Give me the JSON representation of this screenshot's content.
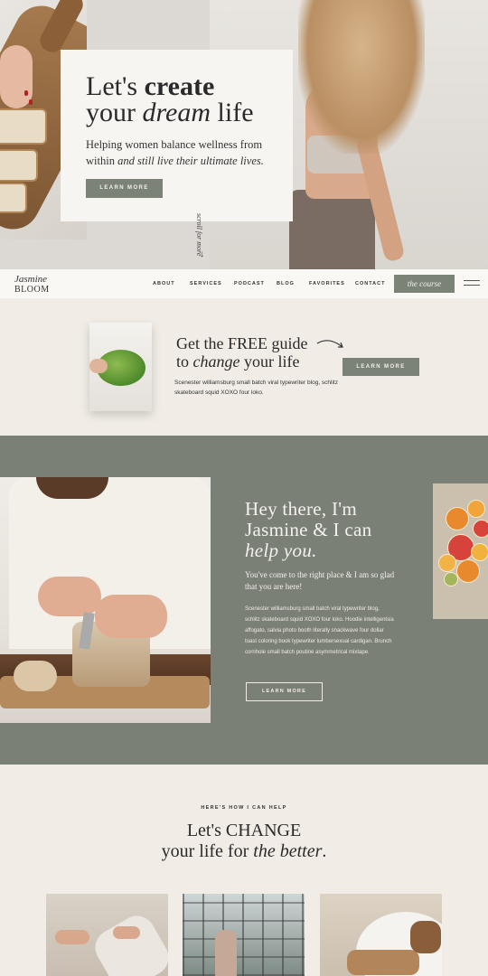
{
  "hero": {
    "title_line1_a": "Let's ",
    "title_line1_b": "create",
    "title_line2_a": "your ",
    "title_line2_b": "dream",
    "title_line2_c": " life",
    "subtitle_a": "Helping women balance wellness from within ",
    "subtitle_b": "and still live their ultimate lives.",
    "button": "LEARN MORE",
    "scroll_hint": "scroll for more",
    "scroll_arrow": "↓"
  },
  "nav": {
    "logo_line1": "Jasmine",
    "logo_line2": "BLOOM",
    "items": [
      "ABOUT",
      "SERVICES",
      "PODCAST",
      "BLOG",
      "FAVORITES",
      "CONTACT"
    ],
    "cta": "the course"
  },
  "guide": {
    "title_line1": "Get the FREE guide",
    "title_line2_a": "to ",
    "title_line2_b": "change",
    "title_line2_c": " your life",
    "text": "Scenester williamsburg small batch viral typewriter blog, schlitz skateboard squid XOXO four loko.",
    "button": "LEARN MORE"
  },
  "about": {
    "title_line1": "Hey there, I'm",
    "title_line2": "Jasmine & I can",
    "title_line3": "help you.",
    "subtitle": "You've come to the right place & I am so glad that you are here!",
    "text": "Scenester williamsburg small batch viral typewriter blog, schlitz skateboard squid XOXO four loko. Hoodie intelligentsia affogato, salvia photo booth literally snackwave four dollar toast coloring book typewriter lumbersexual cardigan. Brunch cornhole small batch poutine asymmetrical mixtape.",
    "button": "LEARN MORE"
  },
  "how": {
    "eyebrow": "HERE'S HOW I CAN HELP",
    "title_line1": "Let's CHANGE",
    "title_line2_a": "your life for ",
    "title_line2_b": "the better",
    "title_line2_c": "."
  },
  "colors": {
    "sage": "#7b8377",
    "sage_dark": "#7b8076",
    "cream": "#f1ede6",
    "card": "#f7f5f1"
  }
}
